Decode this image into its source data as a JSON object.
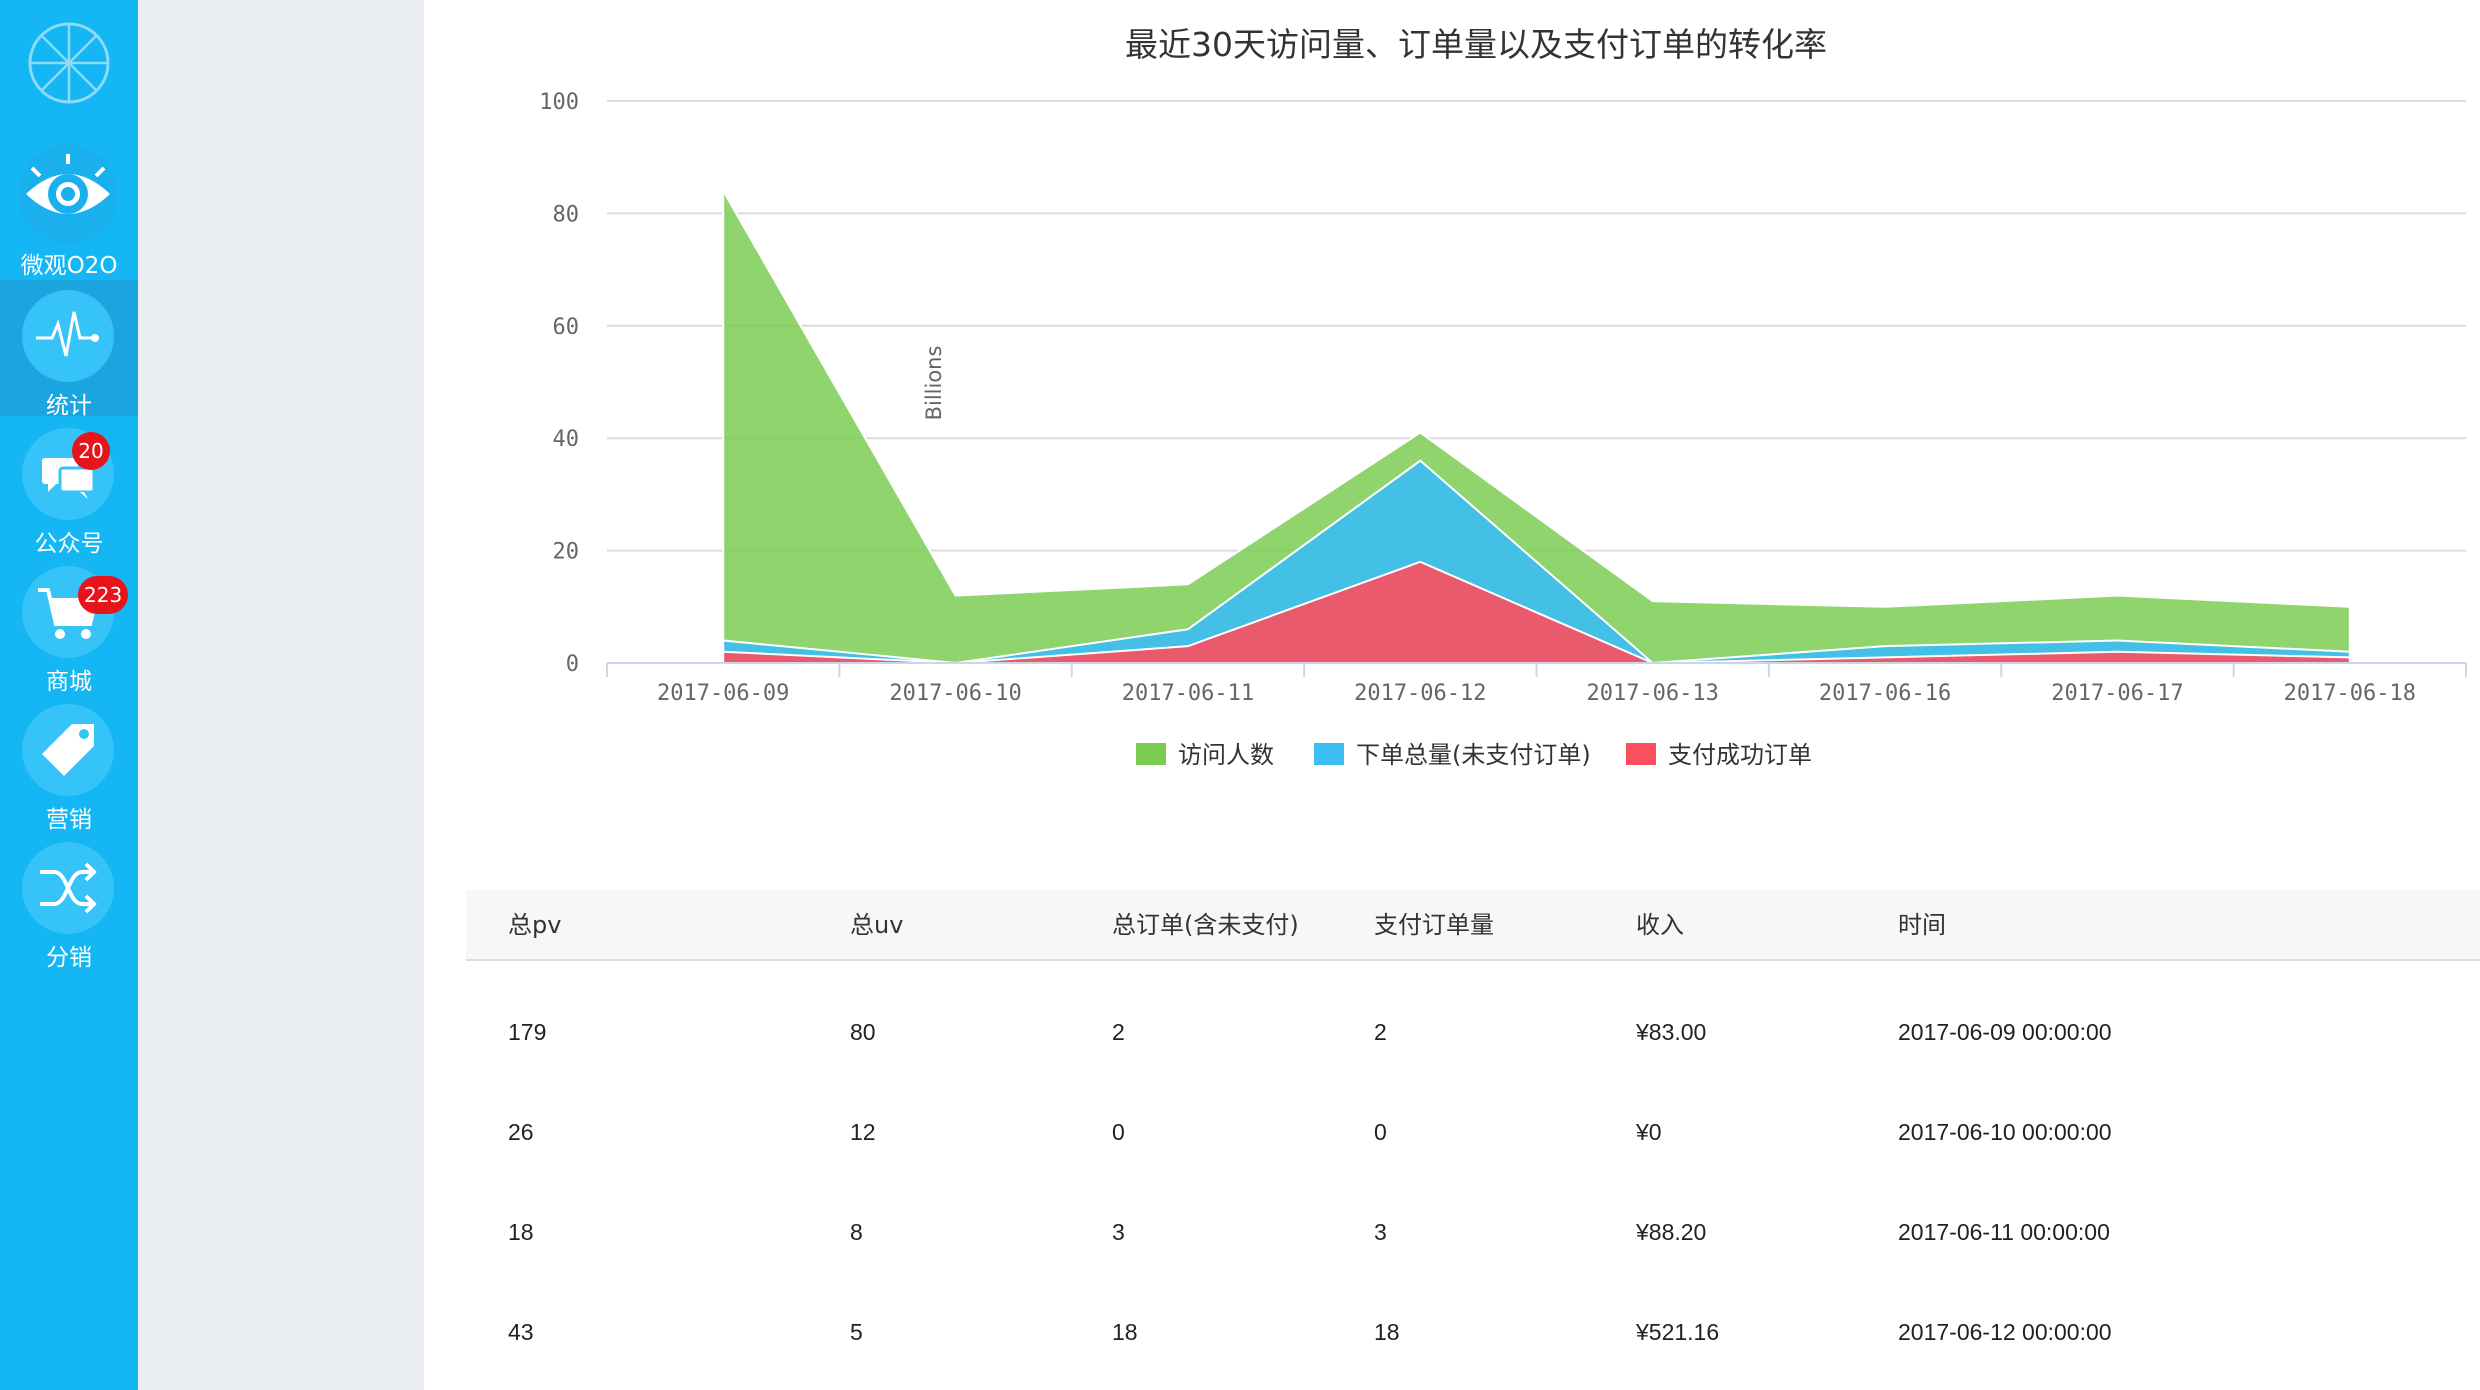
{
  "sidebar": {
    "items": [
      {
        "label": "微观O2O",
        "icon": "eye-icon",
        "badge": ""
      },
      {
        "label": "统计",
        "icon": "pulse-icon",
        "badge": "",
        "active": true
      },
      {
        "label": "公众号",
        "icon": "chat-bubbles-icon",
        "badge": "20"
      },
      {
        "label": "商城",
        "icon": "cart-icon",
        "badge": "223"
      },
      {
        "label": "营销",
        "icon": "tag-icon",
        "badge": ""
      },
      {
        "label": "分销",
        "icon": "shuffle-icon",
        "badge": ""
      }
    ]
  },
  "colors": {
    "sidebar": "#14b7f3",
    "visits": "#7ccc54",
    "orders": "#3cbdf3",
    "paid": "#fb4f5e",
    "badge": "#e8141b"
  },
  "chart_data": {
    "type": "area",
    "title": "最近30天访问量、订单量以及支付订单的转化率",
    "ylabel": "Billions",
    "xlabel": "",
    "ylim": [
      0,
      100
    ],
    "yticks": [
      "0",
      "20",
      "40",
      "60",
      "80",
      "100"
    ],
    "categories": [
      "2017-06-09",
      "2017-06-10",
      "2017-06-11",
      "2017-06-12",
      "2017-06-13",
      "2017-06-16",
      "2017-06-17",
      "2017-06-18"
    ],
    "series": [
      {
        "name": "访问人数",
        "color": "#7ccc54",
        "values": [
          84,
          12,
          14,
          41,
          11,
          10,
          12,
          10
        ]
      },
      {
        "name": "下单总量(未支付订单)",
        "color": "#3cbdf3",
        "values": [
          4,
          0,
          6,
          36,
          0,
          3,
          4,
          2
        ]
      },
      {
        "name": "支付成功订单",
        "color": "#fb4f5e",
        "values": [
          2,
          0,
          3,
          18,
          0,
          1,
          2,
          1
        ]
      }
    ],
    "legend_position": "bottom",
    "grid": true
  },
  "table": {
    "headers": [
      "总pv",
      "总uv",
      "总订单(含未支付)",
      "支付订单量",
      "收入",
      "时间"
    ],
    "rows": [
      [
        "179",
        "80",
        "2",
        "2",
        "¥83.00",
        "2017-06-09 00:00:00"
      ],
      [
        "26",
        "12",
        "0",
        "0",
        "¥0",
        "2017-06-10 00:00:00"
      ],
      [
        "18",
        "8",
        "3",
        "3",
        "¥88.20",
        "2017-06-11 00:00:00"
      ],
      [
        "43",
        "5",
        "18",
        "18",
        "¥521.16",
        "2017-06-12 00:00:00"
      ]
    ]
  }
}
